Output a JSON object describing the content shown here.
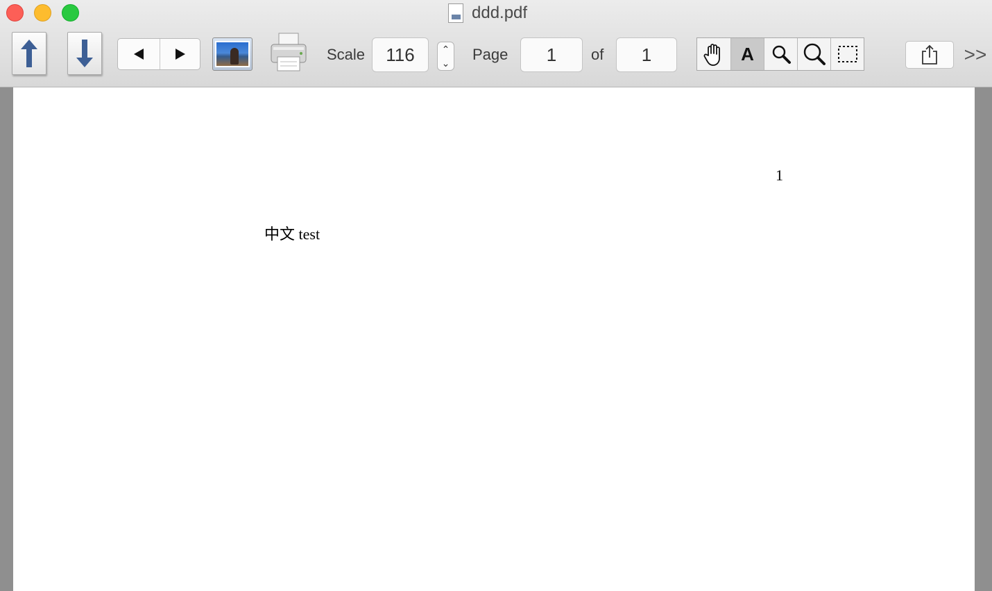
{
  "window": {
    "title": "ddd.pdf"
  },
  "toolbar": {
    "scale_label": "Scale",
    "scale_value": "116",
    "page_label": "Page",
    "page_current": "1",
    "of_label": "of",
    "page_total": "1",
    "tools": [
      "hand-tool",
      "text-tool",
      "zoom-tool",
      "zoom-out-tool",
      "select-tool"
    ],
    "tool_text_glyph": "A",
    "overflow_glyph": ">>"
  },
  "document": {
    "page_number": "1",
    "body_text": "中文 test"
  }
}
